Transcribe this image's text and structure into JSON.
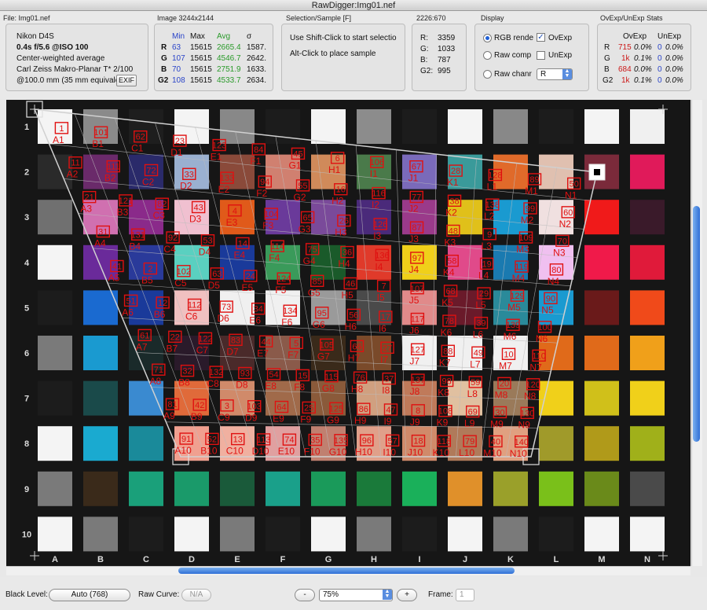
{
  "window": {
    "title": "RawDigger:Img01.nef"
  },
  "file_panel": {
    "title": "File: Img01.nef",
    "camera": "Nikon D4S",
    "exposure": "0.4s f/5.6 @ISO 100",
    "metering": "Center-weighted average",
    "lens": "Carl Zeiss Makro-Planar T* 2/100",
    "focal": "@100.0 mm (35 mm equivale",
    "exif_button": "EXIF"
  },
  "image_panel": {
    "title": "Image 3244x2144",
    "headers": [
      "Min",
      "Max",
      "Avg",
      "σ"
    ],
    "rows": [
      {
        "ch": "R",
        "min": "63",
        "max": "15615",
        "avg": "2665.4",
        "sd": "1587."
      },
      {
        "ch": "G",
        "min": "107",
        "max": "15615",
        "avg": "4546.7",
        "sd": "2642."
      },
      {
        "ch": "B",
        "min": "70",
        "max": "15615",
        "avg": "2751.9",
        "sd": "1633."
      },
      {
        "ch": "G2",
        "min": "108",
        "max": "15615",
        "avg": "4533.7",
        "sd": "2634."
      }
    ]
  },
  "selection_panel": {
    "title": "Selection/Sample [F]",
    "line1": "Use Shift-Click to start selectio",
    "line2": "Alt-Click to place sample"
  },
  "coords_panel": {
    "title": "2226:670",
    "rows": [
      {
        "ch": "R:",
        "val": "3359"
      },
      {
        "ch": "G:",
        "val": "1033"
      },
      {
        "ch": "B:",
        "val": "787"
      },
      {
        "ch": "G2:",
        "val": "995"
      }
    ]
  },
  "display_panel": {
    "title": "Display",
    "radio1": "RGB rende",
    "radio2": "Raw comp",
    "radio3": "Raw chanr",
    "check1": "OvExp",
    "check2": "UnExp",
    "channel_select": "R"
  },
  "stats_panel": {
    "title": "OvExp/UnExp Stats",
    "headers": [
      "OvExp",
      "UnExp"
    ],
    "rows": [
      {
        "ch": "R",
        "ov": "715",
        "ovp": "0.0%",
        "un": "0",
        "unp": "0.0%"
      },
      {
        "ch": "G",
        "ov": "1k",
        "ovp": "0.1%",
        "un": "0",
        "unp": "0.0%"
      },
      {
        "ch": "B",
        "ov": "684",
        "ovp": "0.0%",
        "un": "0",
        "unp": "0.0%"
      },
      {
        "ch": "G2",
        "ov": "1k",
        "ovp": "0.1%",
        "un": "0",
        "unp": "0.0%"
      }
    ]
  },
  "chart": {
    "col_labels": [
      "A",
      "B",
      "C",
      "D",
      "E",
      "F",
      "G",
      "H",
      "I",
      "J",
      "K",
      "L",
      "M",
      "N"
    ],
    "row_labels": [
      "1",
      "2",
      "3",
      "4",
      "5",
      "6",
      "7",
      "8",
      "9",
      "10"
    ],
    "colors": [
      [
        "#f4f4f4",
        "#8a8a8a",
        "#1e1e1e",
        "#f4f4f4",
        "#888888",
        "#1c1c1c",
        "#f4f4f4",
        "#8c8c8c",
        "#1c1c1c",
        "#f4f4f4",
        "#888888",
        "#1c1c1c",
        "#f4f4f4",
        "#f0f0f0"
      ],
      [
        "#2a2a2a",
        "#6a2a6a",
        "#2a2a6a",
        "#9ab0d0",
        "#8a4a3a",
        "#d08070",
        "#d08a5a",
        "#4a7a4a",
        "#7a6aba",
        "#3a9a9a",
        "#e06a2a",
        "#e0c0b0",
        "#7a2a3a",
        "#e01a5a"
      ],
      [
        "#707070",
        "#d070b0",
        "#8a2a8a",
        "#f0c0d0",
        "#e05a1a",
        "#6a3a9a",
        "#7a4a9a",
        "#4a2a7a",
        "#9a3a8a",
        "#e0c01a",
        "#1a9ad0",
        "#f0e0e0",
        "#f01a1a",
        "#3a1a2a"
      ],
      [
        "#f4f4f4",
        "#6a2a9a",
        "#2a3a9a",
        "#5ad0c0",
        "#1a3a9a",
        "#3a9a5a",
        "#1a5a2a",
        "#e03a2a",
        "#f0d01a",
        "#e04a8a",
        "#1a7ab0",
        "#f0c0f0",
        "#f01a4a",
        "#e01a3a"
      ],
      [
        "#1c1c1c",
        "#1a6ad0",
        "#1a3a9a",
        "#f0c0c0",
        "#f0f0f0",
        "#f0f0f0",
        "#9a9a9a",
        "#4a4a4a",
        "#e08a8a",
        "#6a1a2a",
        "#2a8a9a",
        "#1a9ad0",
        "#6a1a1a",
        "#f04a1a"
      ],
      [
        "#7a7a7a",
        "#1a9ad0",
        "#1a2a2a",
        "#2a1a2a",
        "#4a2a2a",
        "#8a5a4a",
        "#3a2a1a",
        "#7a4a2a",
        "#f0f0f0",
        "#f0f0f0",
        "#f0f0f0",
        "#e06a1a",
        "#e06a1a",
        "#f0a01a"
      ],
      [
        "#1c1c1c",
        "#1a4a4a",
        "#3a8ad0",
        "#e06a3a",
        "#d08a6a",
        "#a06a4a",
        "#8a5a3a",
        "#d0a080",
        "#c07a5a",
        "#e0c0a0",
        "#9a7a5a",
        "#f0d01a",
        "#d0c01a",
        "#f0d01a"
      ],
      [
        "#f4f4f4",
        "#1aaad0",
        "#1a8a9a",
        "#f0a090",
        "#f0b0a0",
        "#e0a0a0",
        "#c08070",
        "#e0a08a",
        "#d08a6a",
        "#b07a5a",
        "#e0a080",
        "#a09a2a",
        "#b09a1a",
        "#a0b01a"
      ],
      [
        "#7a7a7a",
        "#3a2a1a",
        "#1aa07a",
        "#1a9a6a",
        "#1a5a3a",
        "#1aa08a",
        "#1a9a5a",
        "#1a7a3a",
        "#1ab05a",
        "#e0902a",
        "#9aa02a",
        "#7ac01a",
        "#6a8a1a",
        "#4a4a4a"
      ],
      [
        "#f4f4f4",
        "#7a7a7a",
        "#1c1c1c",
        "#f4f4f4",
        "#7a7a7a",
        "#1c1c1c",
        "#f4f4f4",
        "#7a7a7a",
        "#1c1c1c",
        "#f4f4f4",
        "#7a7a7a",
        "#1c1c1c",
        "#f4f4f4",
        "#f4f4f4"
      ]
    ],
    "grid_cols": [
      "A",
      "B",
      "C",
      "D",
      "E",
      "F",
      "G",
      "H",
      "I",
      "J",
      "K",
      "L",
      "M",
      "N"
    ],
    "grid_rows": [
      "1",
      "2",
      "3",
      "4",
      "5",
      "6",
      "7",
      "8",
      "9",
      "10"
    ],
    "annotation_labels": [
      "A1",
      "B1",
      "C1",
      "D1",
      "E1",
      "F1",
      "G1",
      "H1",
      "I1",
      "J1",
      "K1",
      "L1",
      "M1",
      "N1",
      "A2",
      "B2",
      "C2",
      "D2",
      "E2",
      "F2",
      "G2",
      "H2",
      "I2",
      "J2",
      "K2",
      "L2",
      "M2",
      "N2",
      "A3",
      "B3",
      "C3",
      "D3",
      "E3",
      "F3",
      "G3",
      "H3",
      "I3",
      "J3",
      "K3",
      "L3",
      "M3",
      "N3",
      "A4",
      "B4",
      "C4",
      "D4",
      "E4",
      "F4",
      "G4",
      "H4",
      "I4",
      "J4",
      "K4",
      "L4",
      "M4",
      "N4",
      "A5",
      "B5",
      "C5",
      "D5",
      "E5",
      "F5",
      "G5",
      "H5",
      "I5",
      "J5",
      "K5",
      "L5",
      "M5",
      "N5",
      "A6",
      "B6",
      "C6",
      "D6",
      "E6",
      "F6",
      "G6",
      "H6",
      "I6",
      "J6",
      "K6",
      "L6",
      "M6",
      "N6",
      "A7",
      "B7",
      "C7",
      "D7",
      "E7",
      "F7",
      "G7",
      "H7",
      "I7",
      "J7",
      "K7",
      "L7",
      "M7",
      "N7",
      "A8",
      "B8",
      "C8",
      "D8",
      "E8",
      "F8",
      "G8",
      "H8",
      "I8",
      "J8",
      "K8",
      "L8",
      "M8",
      "N8",
      "A9",
      "B9",
      "C9",
      "D9",
      "E9",
      "F9",
      "G9",
      "H9",
      "I9",
      "J9",
      "K9",
      "L9",
      "M9",
      "N9",
      "A10",
      "B10",
      "C10",
      "D10",
      "E10",
      "F10",
      "G10",
      "H10",
      "I10",
      "J10",
      "K10",
      "L10",
      "M10",
      "N10"
    ],
    "annotation_numbers": [
      "1",
      "11",
      "21",
      "31",
      "41",
      "51",
      "61",
      "71",
      "81",
      "91",
      "101",
      "111",
      "121",
      "131",
      "2",
      "12",
      "22",
      "32",
      "42",
      "52",
      "62",
      "72",
      "82",
      "92",
      "102",
      "112",
      "122",
      "132",
      "3",
      "13",
      "23",
      "33",
      "43",
      "53",
      "63",
      "73",
      "83",
      "93",
      "103",
      "113",
      "123",
      "133",
      "4",
      "14",
      "24",
      "34",
      "44",
      "54",
      "64",
      "74",
      "84",
      "94",
      "104",
      "114",
      "124",
      "134",
      "5",
      "15",
      "25",
      "35",
      "45",
      "55",
      "65",
      "75",
      "85",
      "95",
      "105",
      "115",
      "125",
      "135",
      "6",
      "16",
      "26",
      "36",
      "46",
      "56",
      "66",
      "76",
      "86",
      "96",
      "106",
      "116",
      "126",
      "136",
      "7",
      "17",
      "27",
      "37",
      "47",
      "57",
      "67",
      "77",
      "87",
      "97",
      "107",
      "117",
      "127",
      "137",
      "8",
      "18",
      "28",
      "38",
      "48",
      "58",
      "68",
      "78",
      "88",
      "98",
      "108",
      "118",
      "128",
      "138",
      "9",
      "19",
      "29",
      "39",
      "49",
      "59",
      "69",
      "79",
      "89",
      "99",
      "109",
      "119",
      "129",
      "139",
      "10",
      "20",
      "30",
      "40",
      "50",
      "60",
      "70",
      "80",
      "90",
      "100",
      "110",
      "120",
      "130",
      "140"
    ]
  },
  "bottom": {
    "black_level_label": "Black Level:",
    "black_level_value": "Auto (768)",
    "raw_curve_label": "Raw Curve:",
    "raw_curve_value": "N/A",
    "zoom_minus": "-",
    "zoom_value": "75%",
    "zoom_plus": "+",
    "frame_label": "Frame:",
    "frame_value": "1"
  }
}
